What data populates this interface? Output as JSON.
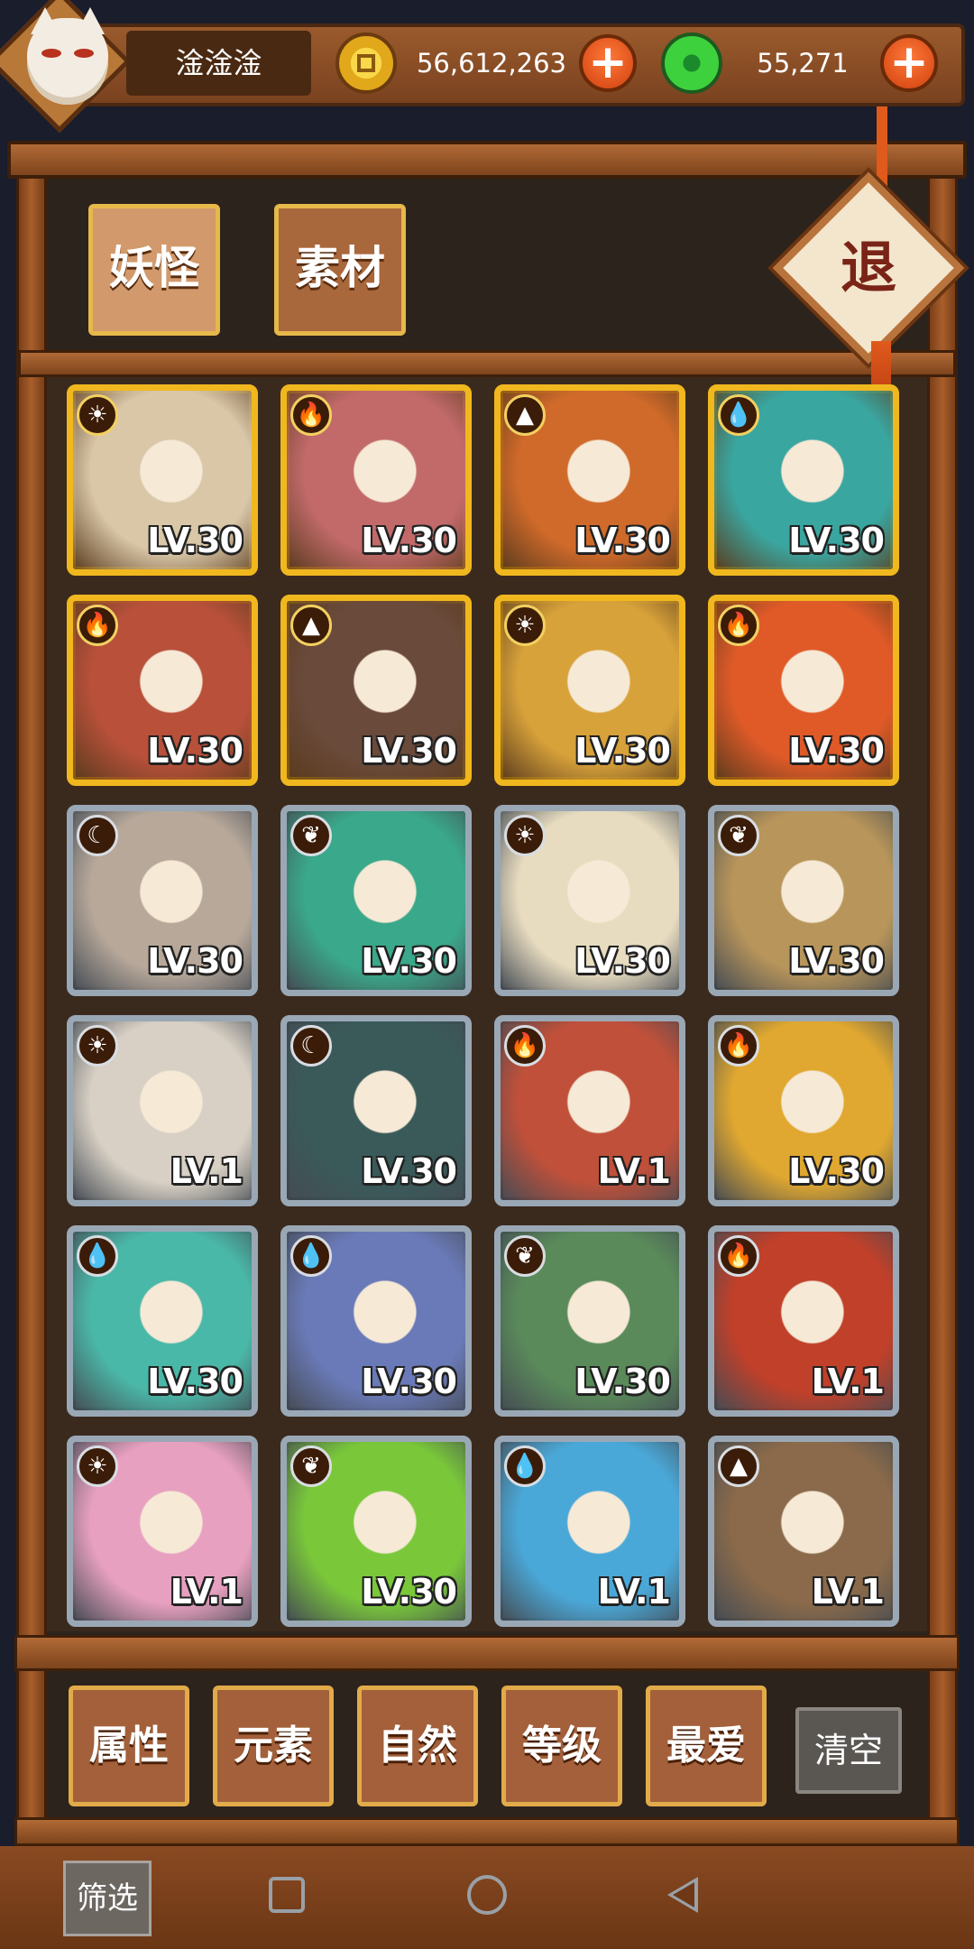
{
  "player": {
    "name": "淦淦淦",
    "avatar_icon": "fox-mask-icon"
  },
  "currency": {
    "gold": {
      "icon": "gold-coin-icon",
      "amount": "56,612,263"
    },
    "jade": {
      "icon": "jade-coin-icon",
      "amount": "55,271"
    },
    "add_icon": "plus-icon"
  },
  "tabs": [
    {
      "label": "妖怪",
      "active": true
    },
    {
      "label": "素材",
      "active": false
    }
  ],
  "exit_label": "退",
  "cards": [
    {
      "element": "sun",
      "element_icon": "sun-element-icon",
      "frame": "gold",
      "level": "LV.30",
      "color": "#d9c7a8"
    },
    {
      "element": "fire",
      "element_icon": "fire-element-icon",
      "frame": "gold",
      "level": "LV.30",
      "color": "#c26a6a"
    },
    {
      "element": "earth",
      "element_icon": "earth-element-icon",
      "frame": "gold",
      "level": "LV.30",
      "color": "#d06a2a"
    },
    {
      "element": "water",
      "element_icon": "water-element-icon",
      "frame": "gold",
      "level": "LV.30",
      "color": "#3aa6a0"
    },
    {
      "element": "fire",
      "element_icon": "fire-element-icon",
      "frame": "gold",
      "level": "LV.30",
      "color": "#b8503a"
    },
    {
      "element": "earth",
      "element_icon": "earth-element-icon",
      "frame": "gold",
      "level": "LV.30",
      "color": "#6a4a3a"
    },
    {
      "element": "sun",
      "element_icon": "sun-element-icon",
      "frame": "gold",
      "level": "LV.30",
      "color": "#d8a23a"
    },
    {
      "element": "fire",
      "element_icon": "fire-element-icon",
      "frame": "gold",
      "level": "LV.30",
      "color": "#e05a28"
    },
    {
      "element": "moon",
      "element_icon": "moon-element-icon",
      "frame": "silver",
      "level": "LV.30",
      "color": "#b7a89a"
    },
    {
      "element": "wood",
      "element_icon": "wood-element-icon",
      "frame": "silver",
      "level": "LV.30",
      "color": "#3aa88a"
    },
    {
      "element": "sun",
      "element_icon": "sun-element-icon",
      "frame": "silver",
      "level": "LV.30",
      "color": "#e8dcc0"
    },
    {
      "element": "wood",
      "element_icon": "wood-element-icon",
      "frame": "silver",
      "level": "LV.30",
      "color": "#b8955a"
    },
    {
      "element": "sun",
      "element_icon": "sun-element-icon",
      "frame": "silver",
      "level": "LV.1",
      "color": "#d8d0c4"
    },
    {
      "element": "moon",
      "element_icon": "moon-element-icon",
      "frame": "silver",
      "level": "LV.30",
      "color": "#3a5a5a"
    },
    {
      "element": "fire",
      "element_icon": "fire-element-icon",
      "frame": "silver",
      "level": "LV.1",
      "color": "#c0503a"
    },
    {
      "element": "fire",
      "element_icon": "fire-element-icon",
      "frame": "silver",
      "level": "LV.30",
      "color": "#e0a830"
    },
    {
      "element": "water",
      "element_icon": "water-element-icon",
      "frame": "silver",
      "level": "LV.30",
      "color": "#4ab8a8"
    },
    {
      "element": "water",
      "element_icon": "water-element-icon",
      "frame": "silver",
      "level": "LV.30",
      "color": "#6a7ab8"
    },
    {
      "element": "wood",
      "element_icon": "wood-element-icon",
      "frame": "silver",
      "level": "LV.30",
      "color": "#5a8a5a"
    },
    {
      "element": "fire",
      "element_icon": "fire-element-icon",
      "frame": "silver",
      "level": "LV.1",
      "color": "#c0402a"
    },
    {
      "element": "sun",
      "element_icon": "sun-element-icon",
      "frame": "silver",
      "level": "LV.1",
      "color": "#e8a0c0"
    },
    {
      "element": "wood",
      "element_icon": "wood-element-icon",
      "frame": "silver",
      "level": "LV.30",
      "color": "#7ac83a"
    },
    {
      "element": "water",
      "element_icon": "water-element-icon",
      "frame": "silver",
      "level": "LV.1",
      "color": "#4aa8d8"
    },
    {
      "element": "earth",
      "element_icon": "earth-element-icon",
      "frame": "silver",
      "level": "LV.1",
      "color": "#8a6a4a"
    }
  ],
  "filters": [
    {
      "label": "属性"
    },
    {
      "label": "元素"
    },
    {
      "label": "自然"
    },
    {
      "label": "等级"
    },
    {
      "label": "最爱"
    }
  ],
  "clear_label": "清空",
  "filter_chip_label": "筛选",
  "nav": {
    "recent_icon": "square-icon",
    "home_icon": "circle-icon",
    "back_icon": "triangle-back-icon"
  }
}
